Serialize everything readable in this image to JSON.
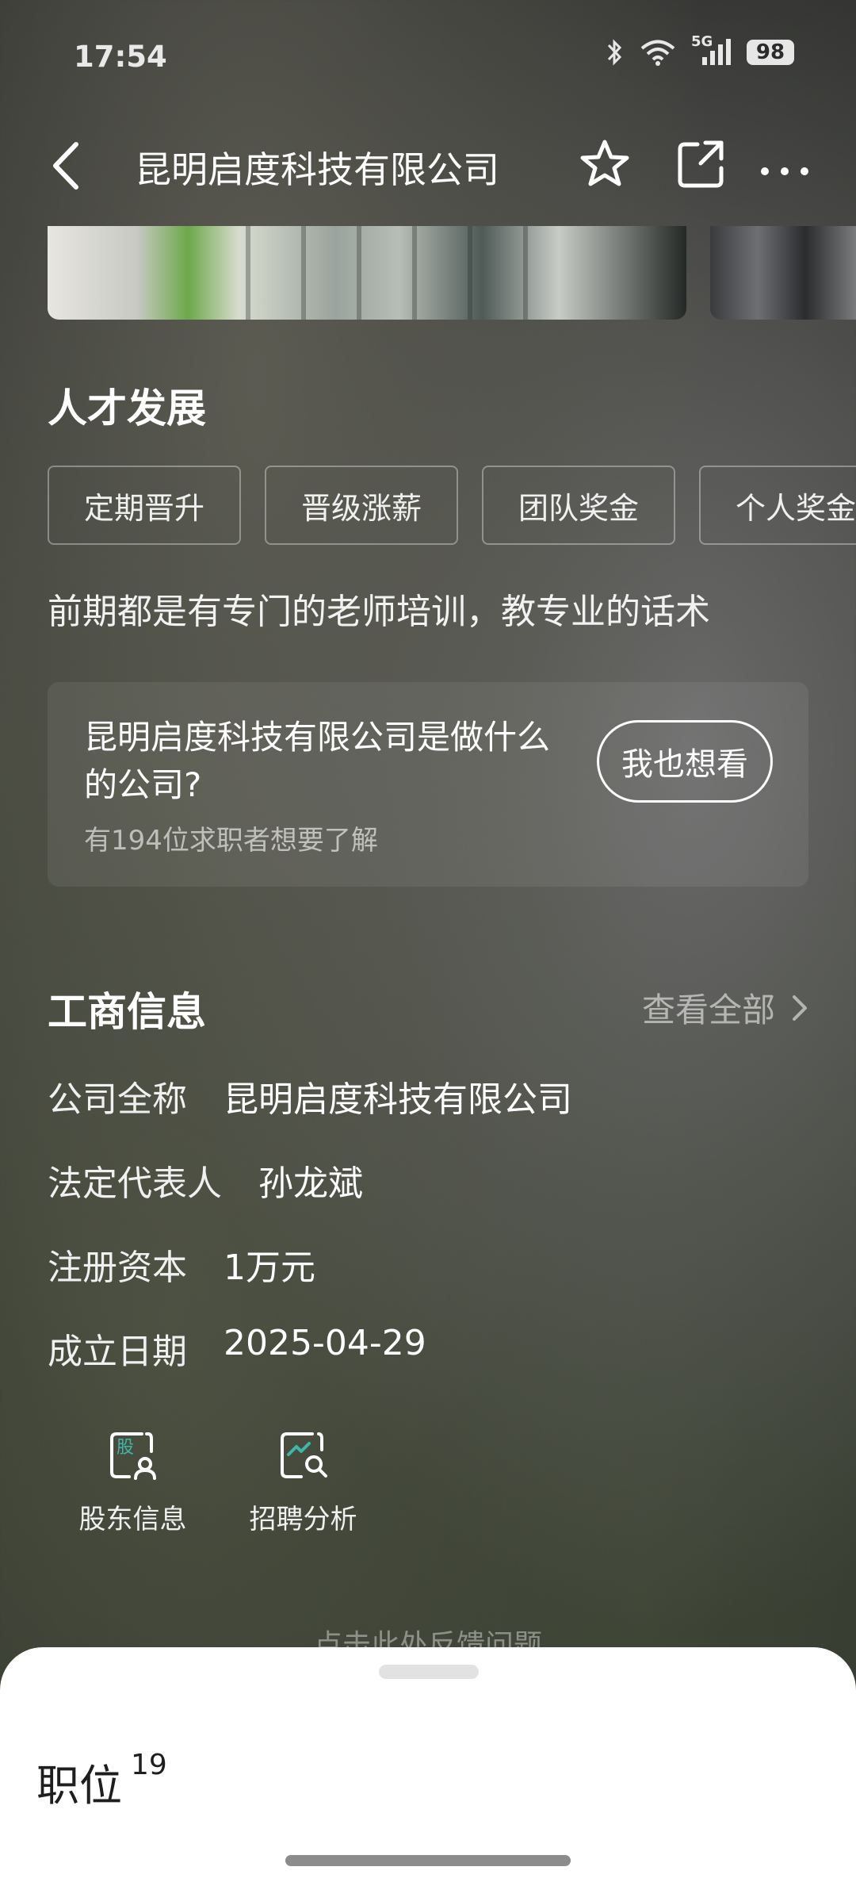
{
  "status_bar": {
    "time": "17:54",
    "network": "5G",
    "battery": "98",
    "icons": [
      "bluetooth-icon",
      "wifi-icon",
      "signal-icon",
      "battery-icon"
    ]
  },
  "nav": {
    "title": "昆明启度科技有限公司",
    "icons": [
      "back-icon",
      "star-icon",
      "share-icon",
      "more-icon"
    ]
  },
  "talent": {
    "title": "人才发展",
    "tags": [
      "定期晋升",
      "晋级涨薪",
      "团队奖金",
      "个人奖金"
    ],
    "description": "前期都是有专门的老师培训，教专业的话术"
  },
  "ask_card": {
    "question": "昆明启度科技有限公司是做什么的公司?",
    "count_text": "有194位求职者想要了解",
    "button": "我也想看"
  },
  "business_info": {
    "title": "工商信息",
    "view_all": "查看全部",
    "rows": [
      {
        "label": "公司全称",
        "value": "昆明启度科技有限公司"
      },
      {
        "label": "法定代表人",
        "value": "孙龙斌"
      },
      {
        "label": "注册资本",
        "value": "1万元"
      },
      {
        "label": "成立日期",
        "value": "2025-04-29"
      }
    ],
    "quick_links": [
      {
        "label": "股东信息",
        "icon": "shareholder-icon",
        "icon_text": "股"
      },
      {
        "label": "招聘分析",
        "icon": "recruit-analysis-icon"
      }
    ]
  },
  "feedback_text": "点击此处反馈问题",
  "bottom_sheet": {
    "title": "职位",
    "count": "19"
  },
  "colors": {
    "accent_teal": "#3fb6a8",
    "sheet_bg": "#ffffff"
  }
}
